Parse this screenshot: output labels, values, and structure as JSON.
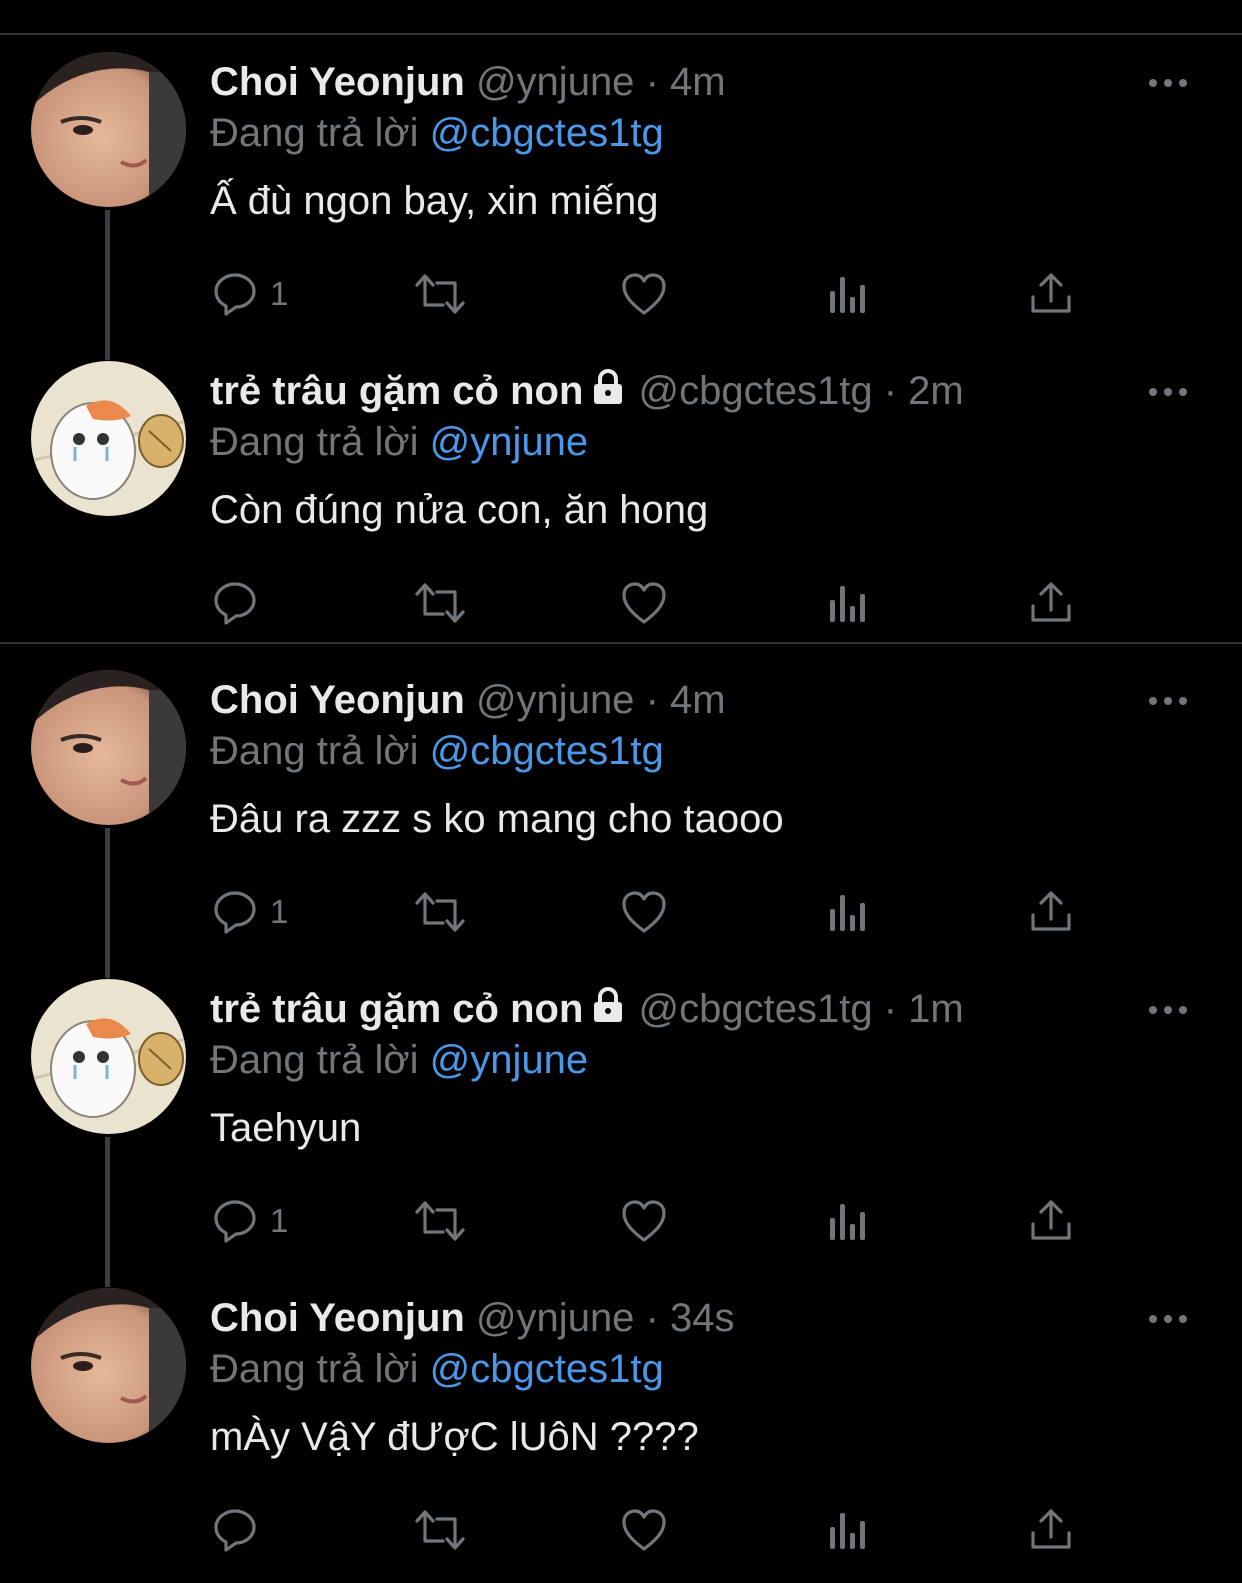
{
  "reply_prefix": "Đang trả lời",
  "tweets": [
    {
      "name": "Choi Yeonjun",
      "handle": "@ynjune",
      "time": "4m",
      "locked": false,
      "avatar_icon": "person-photo-avatar",
      "reply_to": "@cbgctes1tg",
      "text": "Ấ đù ngon bay, xin miếng",
      "reply_count": "1"
    },
    {
      "name": "trẻ trâu gặm cỏ non",
      "handle": "@cbgctes1tg",
      "time": "2m",
      "locked": true,
      "avatar_icon": "hamster-cartoon-avatar",
      "reply_to": "@ynjune",
      "text": "Còn đúng nửa con, ăn hong",
      "reply_count": ""
    },
    {
      "name": "Choi Yeonjun",
      "handle": "@ynjune",
      "time": "4m",
      "locked": false,
      "avatar_icon": "person-photo-avatar",
      "reply_to": "@cbgctes1tg",
      "text": "Đâu ra zzz s ko mang cho taooo",
      "reply_count": "1"
    },
    {
      "name": "trẻ trâu gặm cỏ non",
      "handle": "@cbgctes1tg",
      "time": "1m",
      "locked": true,
      "avatar_icon": "hamster-cartoon-avatar",
      "reply_to": "@ynjune",
      "text": "Taehyun",
      "reply_count": "1"
    },
    {
      "name": "Choi Yeonjun",
      "handle": "@ynjune",
      "time": "34s",
      "locked": false,
      "avatar_icon": "person-photo-avatar",
      "reply_to": "@cbgctes1tg",
      "text": "mÀy VậY đƯợC lUôN ????",
      "reply_count": ""
    }
  ],
  "colors": {
    "background": "#000000",
    "text": "#e7e9ea",
    "muted": "#71767b",
    "mention": "#4a99e9",
    "divider": "#2f3336"
  }
}
